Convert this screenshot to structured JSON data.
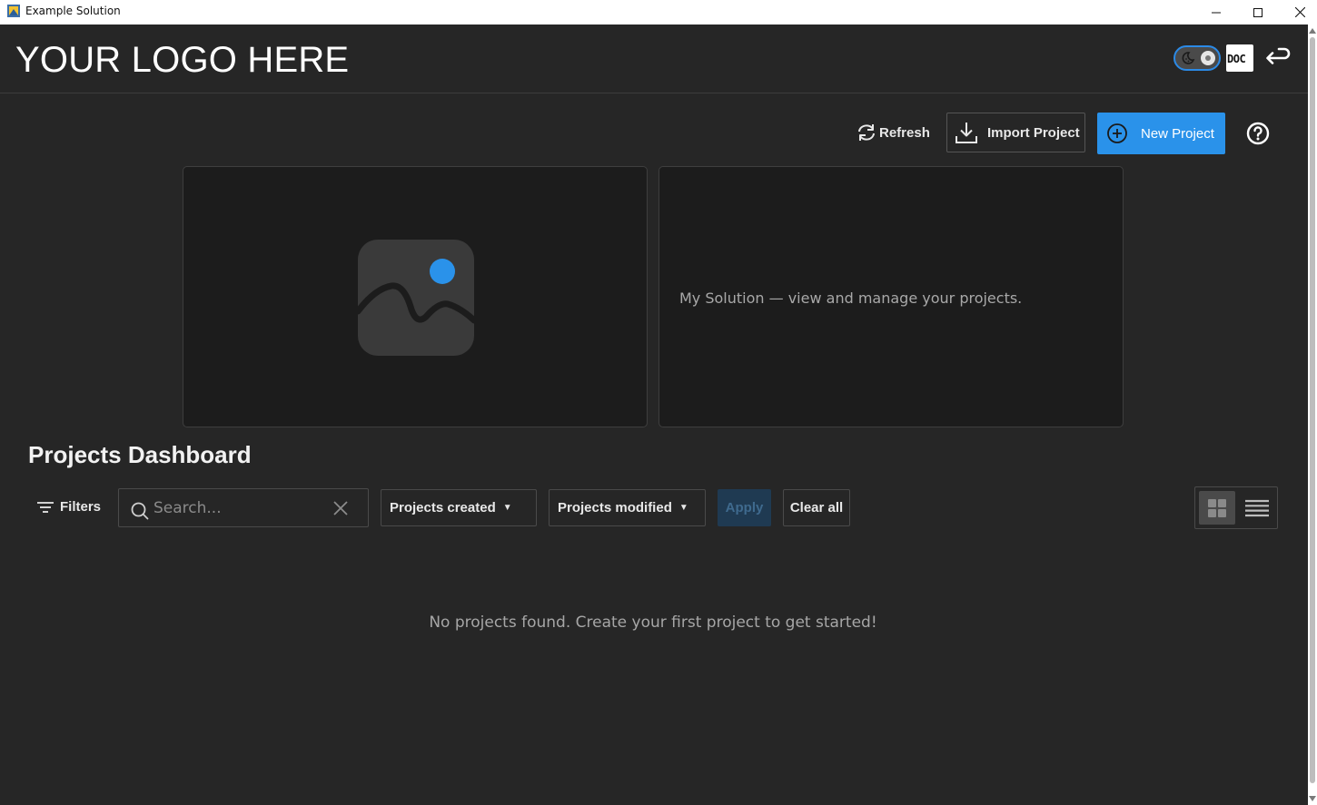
{
  "window": {
    "title": "Example Solution"
  },
  "header": {
    "logo_text": "YOUR LOGO HERE",
    "doc_label": "DOC"
  },
  "toolbar": {
    "refresh_label": "Refresh",
    "import_label": "Import Project",
    "new_label": "New Project"
  },
  "hero": {
    "description": "My Solution — view and manage your projects."
  },
  "dashboard": {
    "title": "Projects Dashboard",
    "filters_label": "Filters",
    "search_placeholder": "Search...",
    "dropdown_created": "Projects created",
    "dropdown_modified": "Projects modified",
    "apply_label": "Apply",
    "clear_label": "Clear all",
    "empty_message": "No projects found. Create your first project to get started!"
  },
  "colors": {
    "accent": "#2a92ea",
    "background": "#262626",
    "card": "#1c1c1c"
  },
  "icons": {
    "refresh": "refresh-icon",
    "import": "download-icon",
    "new": "plus-circle-icon",
    "help": "question-circle-icon",
    "filter": "filter-icon",
    "search": "search-icon",
    "clear": "close-icon",
    "grid": "grid-view-icon",
    "list": "list-view-icon",
    "theme": "theme-toggle",
    "doc": "doc-icon",
    "back": "return-arrow-icon"
  }
}
